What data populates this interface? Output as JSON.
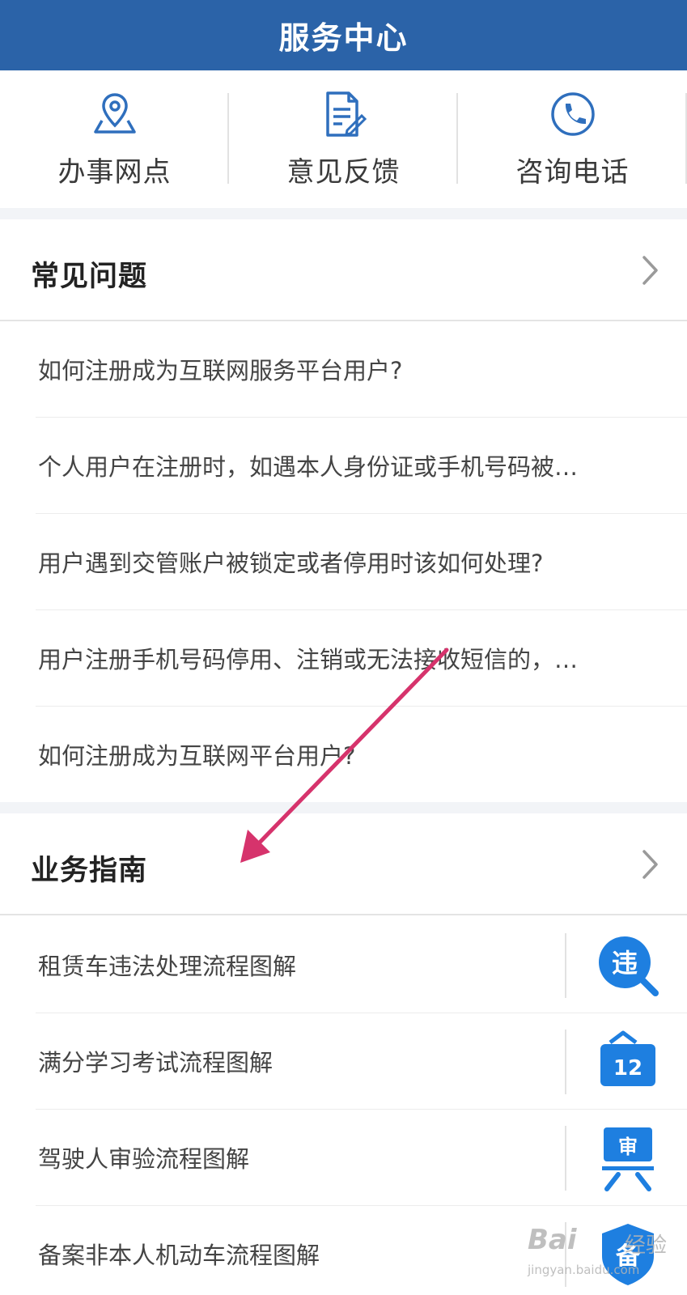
{
  "header": {
    "title": "服务中心"
  },
  "quick_actions": [
    {
      "label": "办事网点",
      "icon": "location-map-icon"
    },
    {
      "label": "意见反馈",
      "icon": "feedback-document-icon"
    },
    {
      "label": "咨询电话",
      "icon": "phone-icon"
    }
  ],
  "faq": {
    "title": "常见问题",
    "items": [
      "如何注册成为互联网服务平台用户?",
      "个人用户在注册时，如遇本人身份证或手机号码被…",
      "用户遇到交管账户被锁定或者停用时该如何处理?",
      "用户注册手机号码停用、注销或无法接收短信的，…",
      "如何注册成为互联网平台用户?"
    ]
  },
  "guide": {
    "title": "业务指南",
    "items": [
      {
        "label": "租赁车违法处理流程图解",
        "icon": "violation-search-icon",
        "icon_text": "违"
      },
      {
        "label": "满分学习考试流程图解",
        "icon": "calendar-icon",
        "icon_text": "12"
      },
      {
        "label": "驾驶人审验流程图解",
        "icon": "review-icon",
        "icon_text": "审"
      },
      {
        "label": "备案非本人机动车流程图解",
        "icon": "shield-record-icon",
        "icon_text": "备"
      }
    ]
  },
  "watermark": {
    "brand": "Bai",
    "brand2": "经验",
    "sub": "jingyan.baidu.com"
  },
  "colors": {
    "header": "#2b63a8",
    "accent": "#2f6fbd",
    "arrow": "#d6336c",
    "icon_blue": "#1e7fe0"
  }
}
